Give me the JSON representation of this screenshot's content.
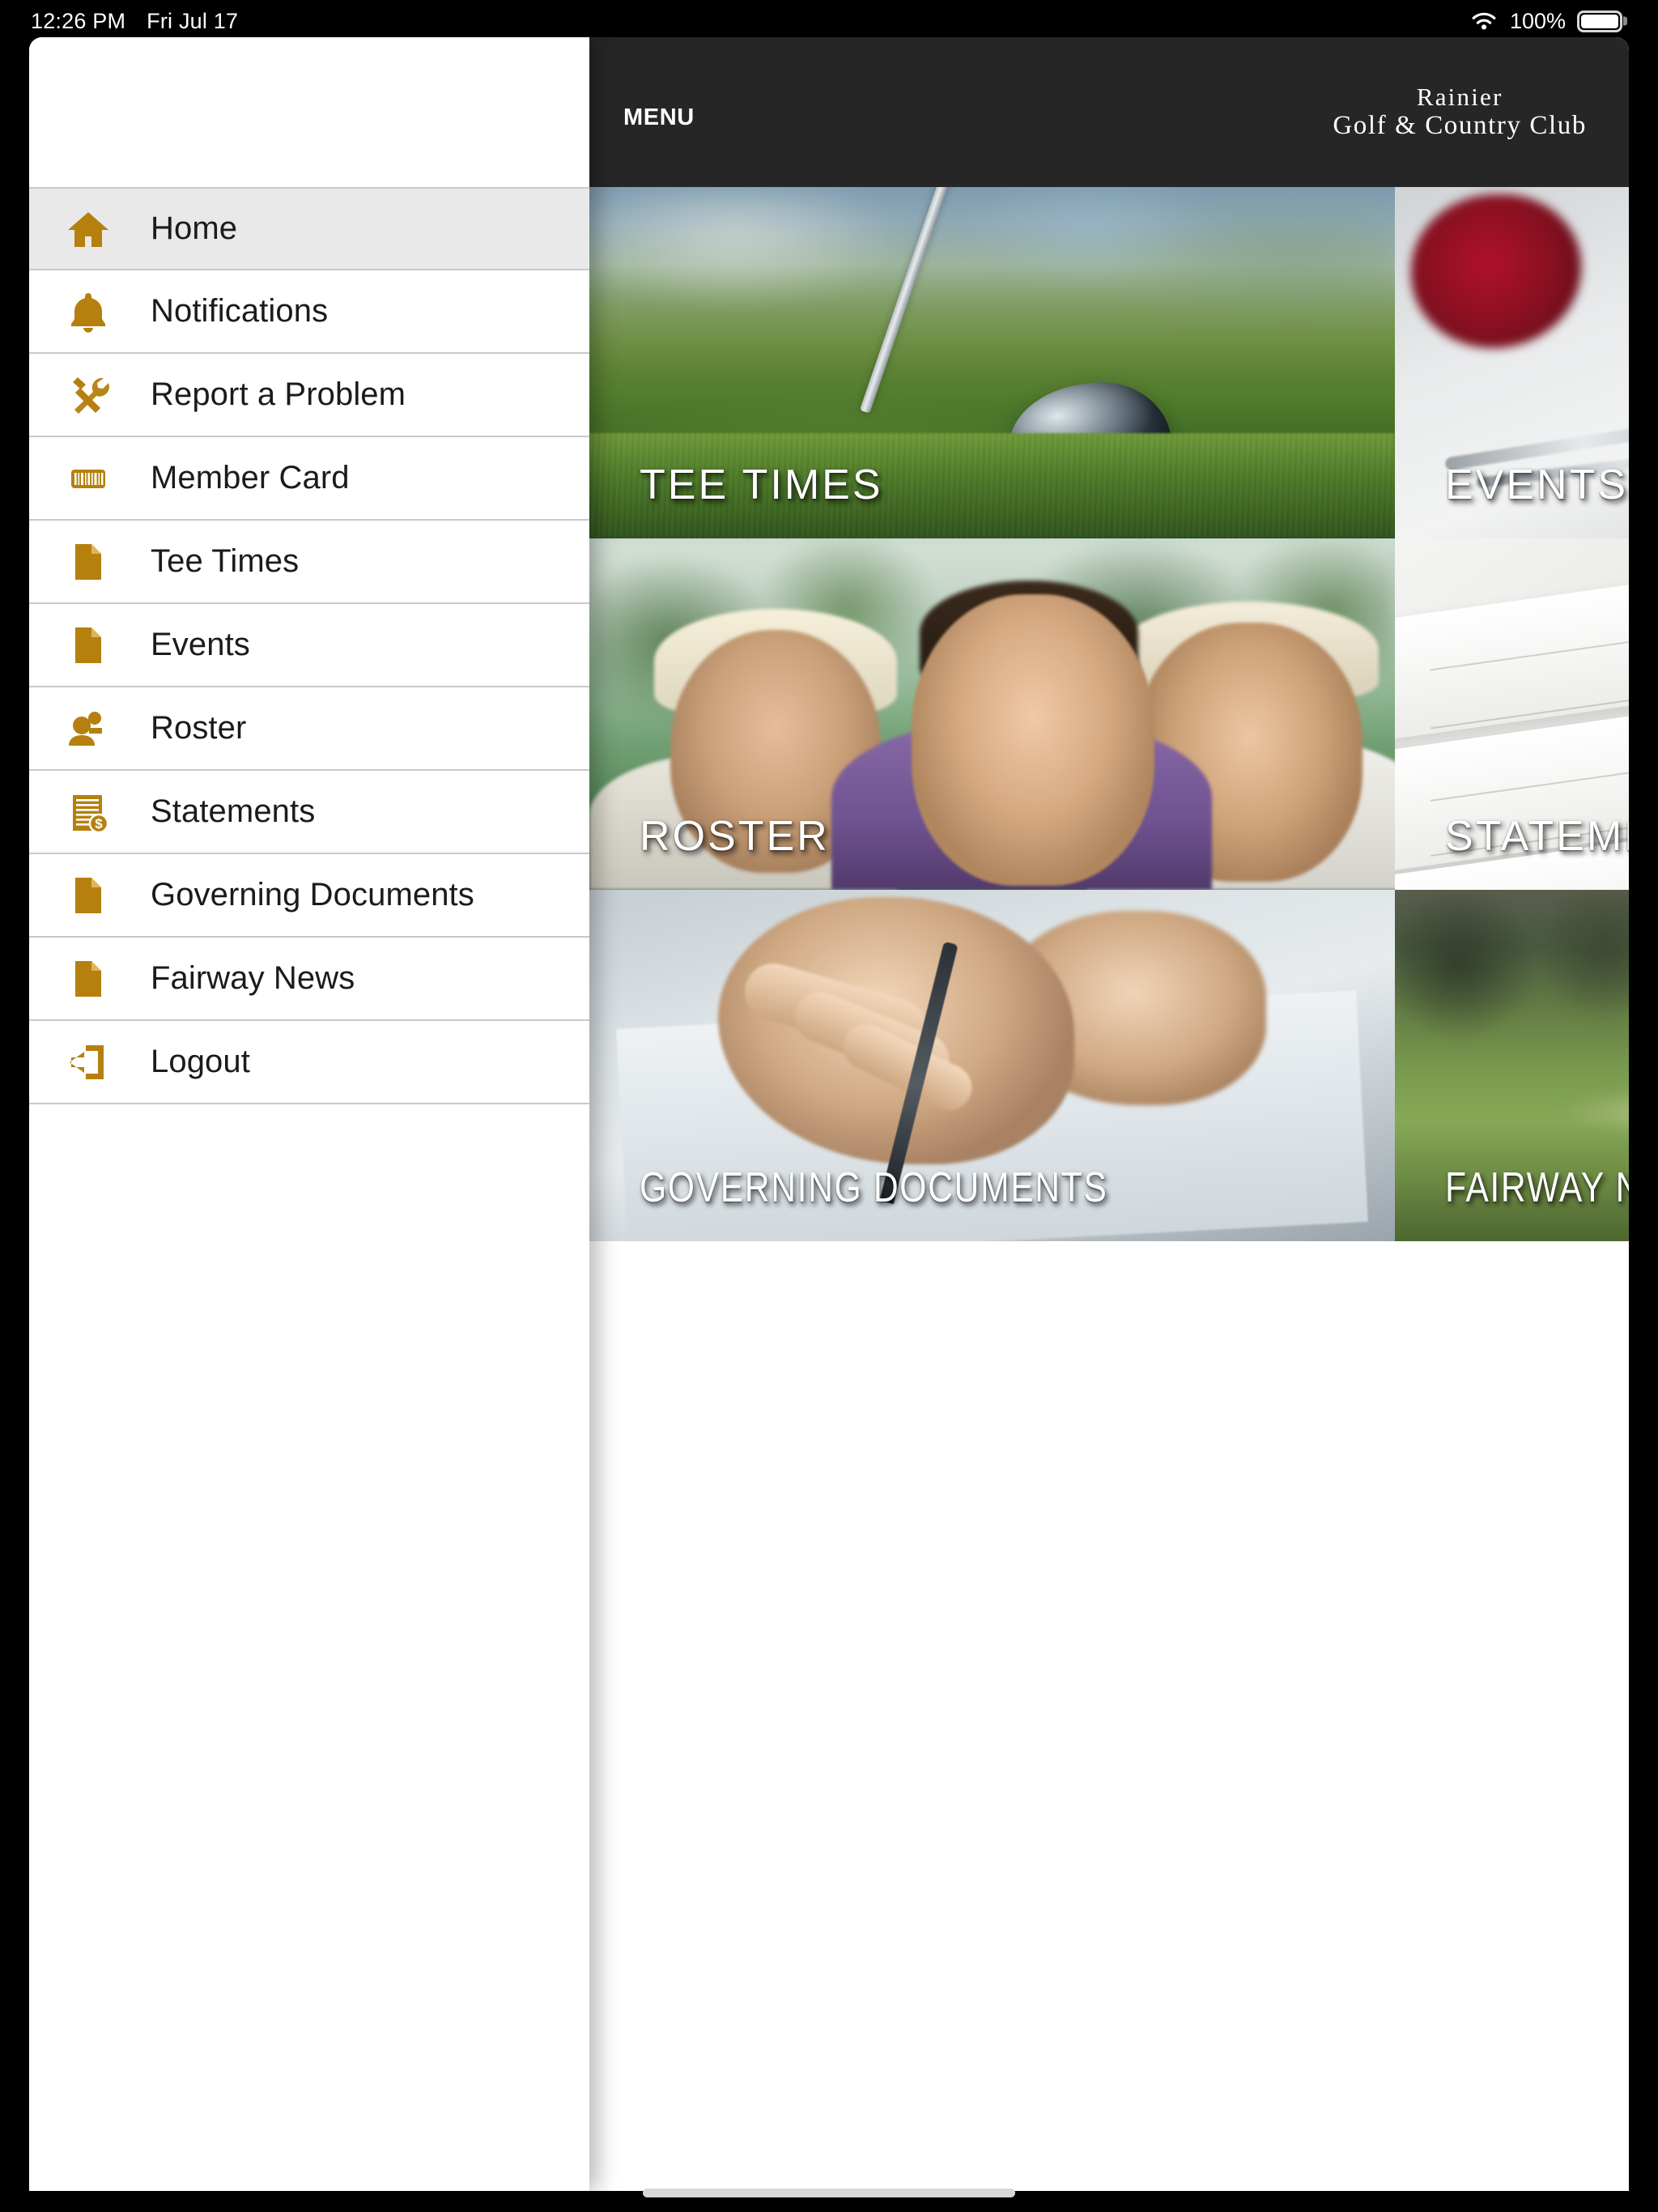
{
  "status_bar": {
    "time": "12:26 PM",
    "date": "Fri Jul 17",
    "battery_percent": "100%",
    "wifi_icon": "wifi-icon",
    "battery_icon": "battery-full-icon"
  },
  "app_bar": {
    "menu_label": "MENU",
    "menu_icon": "hamburger-menu-icon",
    "brand_line1": "Rainier",
    "brand_line2": "Golf & Country Club",
    "background_color": "#262626"
  },
  "sidebar": {
    "accent_color": "#b5800e",
    "active_row_color": "#e9e9e9",
    "items": [
      {
        "label": "Home",
        "icon": "home-icon",
        "active": true
      },
      {
        "label": "Notifications",
        "icon": "bell-icon",
        "active": false
      },
      {
        "label": "Report a Problem",
        "icon": "tools-icon",
        "active": false
      },
      {
        "label": "Member Card",
        "icon": "barcode-icon",
        "active": false
      },
      {
        "label": "Tee Times",
        "icon": "document-icon",
        "active": false
      },
      {
        "label": "Events",
        "icon": "document-icon",
        "active": false
      },
      {
        "label": "Roster",
        "icon": "people-icon",
        "active": false
      },
      {
        "label": "Statements",
        "icon": "invoice-dollar-icon",
        "active": false
      },
      {
        "label": "Governing Documents",
        "icon": "document-icon",
        "active": false
      },
      {
        "label": "Fairway News",
        "icon": "document-icon",
        "active": false
      },
      {
        "label": "Logout",
        "icon": "logout-icon",
        "active": false
      }
    ]
  },
  "tiles": [
    {
      "label": "TEE TIMES",
      "photo": "golf-driver-on-fairway"
    },
    {
      "label": "EVENTS",
      "photo": "table-setting-with-roses"
    },
    {
      "label": "ROSTER",
      "photo": "group-of-smiling-golfers"
    },
    {
      "label": "STATEMENTS",
      "photo": "stacked-invoice-papers"
    },
    {
      "label": "GOVERNING DOCUMENTS",
      "photo": "hand-signing-document"
    },
    {
      "label": "FAIRWAY NEWS",
      "photo": "golf-course-greens-with-trees"
    }
  ]
}
